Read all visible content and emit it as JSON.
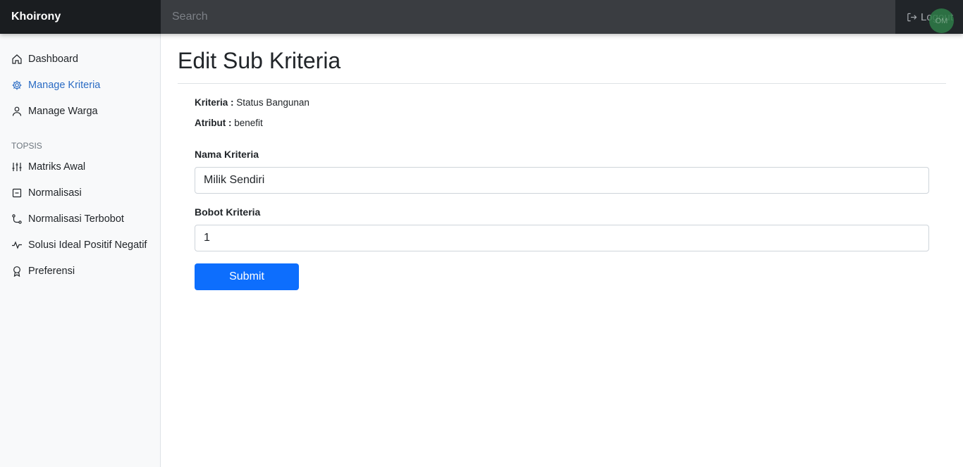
{
  "navbar": {
    "brand": "Khoirony",
    "search_placeholder": "Search",
    "logout_label": "Logout",
    "avatar_text": "OM",
    "logout_icon": "box-arrow-right-icon"
  },
  "sidebar": {
    "items": [
      {
        "label": "Dashboard",
        "icon": "house-icon",
        "active": false
      },
      {
        "label": "Manage Kriteria",
        "icon": "gear-icon",
        "active": true
      },
      {
        "label": "Manage Warga",
        "icon": "person-icon",
        "active": false
      }
    ],
    "section_heading": "TOPSIS",
    "topsis_items": [
      {
        "label": "Matriks Awal",
        "icon": "sliders-icon"
      },
      {
        "label": "Normalisasi",
        "icon": "file-minus-icon"
      },
      {
        "label": "Normalisasi Terbobot",
        "icon": "bezier-icon"
      },
      {
        "label": "Solusi Ideal Positif Negatif",
        "icon": "activity-icon"
      },
      {
        "label": "Preferensi",
        "icon": "award-icon"
      }
    ],
    "active_color": "#2b6cc4"
  },
  "main": {
    "title": "Edit Sub Kriteria",
    "kriteria_label": "Kriteria :",
    "kriteria_value": "Status Bangunan",
    "atribut_label": "Atribut :",
    "atribut_value": "benefit",
    "nama_label": "Nama Kriteria",
    "nama_value": "Milik Sendiri",
    "bobot_label": "Bobot Kriteria",
    "bobot_value": "1",
    "submit_label": "Submit",
    "submit_color": "#0d6efd"
  }
}
